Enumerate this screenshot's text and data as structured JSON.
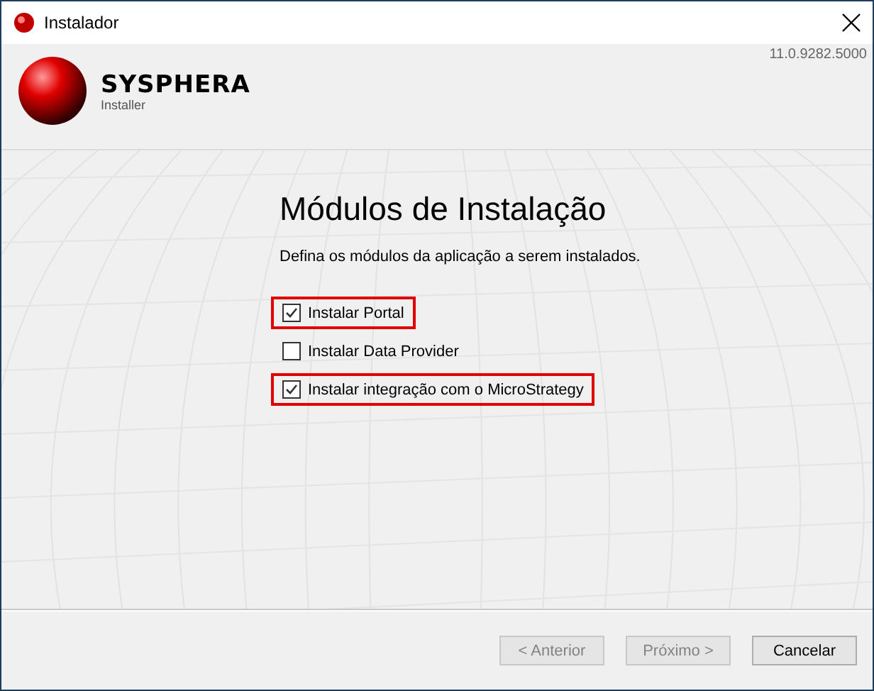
{
  "window": {
    "title": "Instalador"
  },
  "header": {
    "product": "SYSPHERA",
    "subtitle": "Installer",
    "version": "11.0.9282.5000"
  },
  "page": {
    "title": "Módulos de Instalação",
    "description": "Defina os módulos da aplicação a serem instalados."
  },
  "options": [
    {
      "label": "Instalar Portal",
      "checked": true,
      "highlighted": true
    },
    {
      "label": "Instalar Data Provider",
      "checked": false,
      "highlighted": false
    },
    {
      "label": "Instalar integração com o MicroStrategy",
      "checked": true,
      "highlighted": true
    }
  ],
  "buttons": [
    {
      "label": "< Anterior",
      "disabled": true
    },
    {
      "label": "Próximo >",
      "disabled": true
    },
    {
      "label": "Cancelar",
      "disabled": false
    }
  ]
}
